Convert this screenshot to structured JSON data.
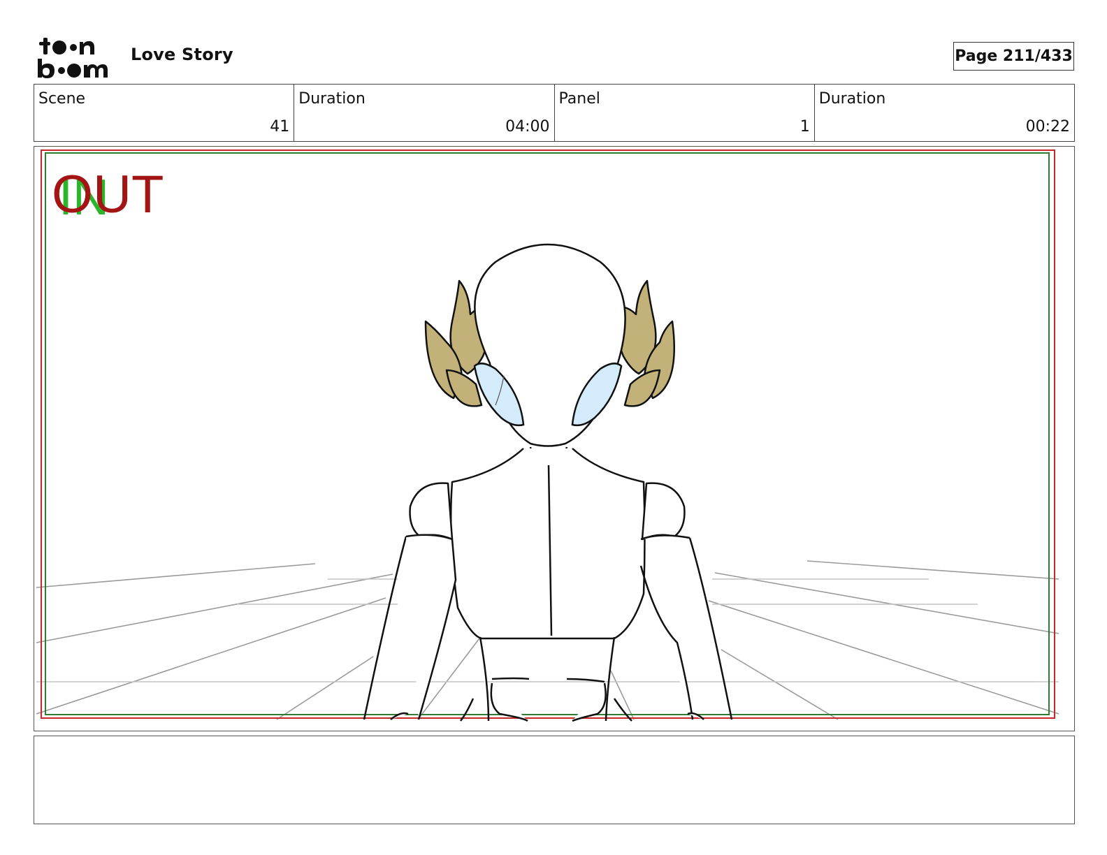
{
  "header": {
    "brand_top": "toon",
    "brand_bottom": "boom",
    "project_title": "Love Story",
    "page_label": "Page 211/433"
  },
  "info": [
    {
      "label": "Scene",
      "value": "41"
    },
    {
      "label": "Duration",
      "value": "04:00"
    },
    {
      "label": "Panel",
      "value": "1"
    },
    {
      "label": "Duration",
      "value": "00:22"
    }
  ],
  "panel": {
    "in_marker": "IN",
    "out_marker": "OUT",
    "colors": {
      "in": "#2bb52b",
      "out": "#a31515",
      "safe_frame": "#2e7d32",
      "camera_frame": "#c62828",
      "hair": "#c2b27a",
      "eyes": "#d4ebfb",
      "line": "#111111",
      "perspective": "#9a9a9a"
    }
  },
  "notes": {
    "text": ""
  }
}
